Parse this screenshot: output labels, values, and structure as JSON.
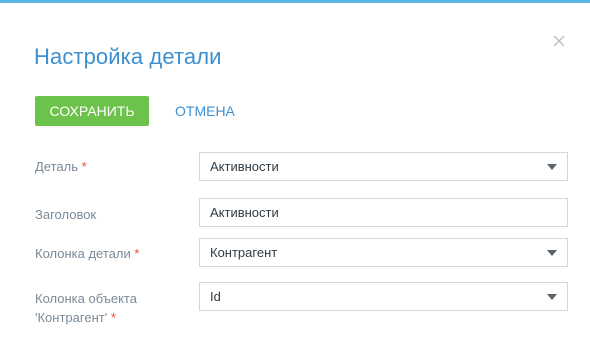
{
  "dialog": {
    "title": "Настройка детали",
    "close_icon": "close-icon"
  },
  "toolbar": {
    "save_label": "СОХРАНИТЬ",
    "cancel_label": "ОТМЕНА"
  },
  "form": {
    "required_mark": "*",
    "fields": [
      {
        "label": "Деталь",
        "required": true,
        "type": "select",
        "value": "Активности"
      },
      {
        "label": "Заголовок",
        "required": false,
        "type": "text",
        "value": "Активности"
      },
      {
        "label": "Колонка детали",
        "required": true,
        "type": "select",
        "value": "Контрагент"
      },
      {
        "label_line1": "Колонка объекта",
        "label_line2": "'Контрагент'",
        "required": true,
        "type": "select",
        "value": "Id"
      }
    ]
  },
  "colors": {
    "accent": "#3d8fd0",
    "top_border": "#5ab5e6",
    "save_button": "#6cc24a",
    "required": "#e8502c",
    "label": "#7b8a97"
  }
}
